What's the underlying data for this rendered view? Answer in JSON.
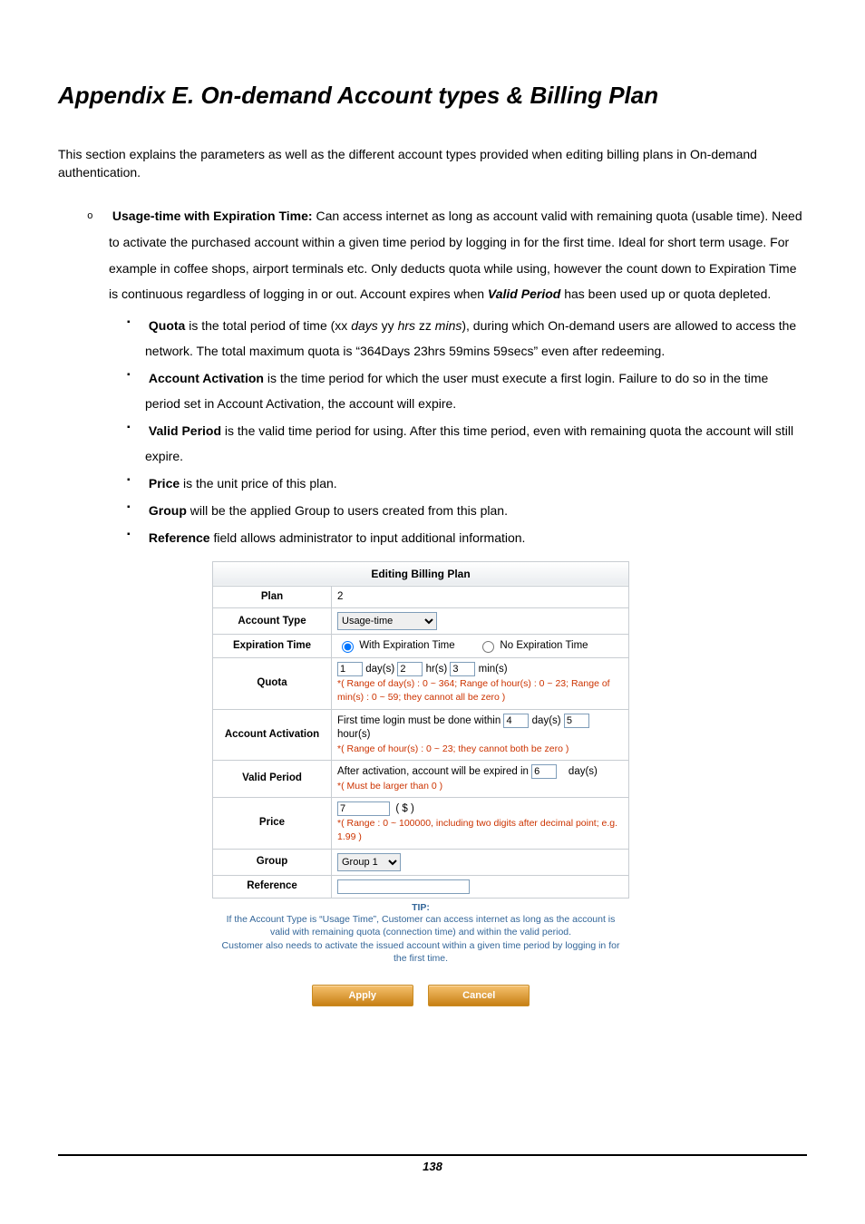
{
  "title": "Appendix E.  On-demand Account types & Billing Plan",
  "intro": "This section explains the parameters as well as the different account types provided when editing billing plans in On-demand authentication.",
  "bullet_main": {
    "strong": "Usage-time with Expiration Time:",
    "text_a": " Can access internet as long as account valid with remaining quota (usable time). Need to activate the purchased account within a given time period by logging in for the first time. Ideal for short term usage. For example in coffee shops, airport terminals etc. Only deducts quota while using, however the count down to Expiration Time is continuous regardless of logging in or out. Account expires when ",
    "emph": "Valid Period",
    "text_b": " has been used up or quota depleted."
  },
  "sub_bullets": {
    "quota": {
      "strong": "Quota",
      "a": " is the total period of time (xx ",
      "i1": "days",
      "b1": " yy ",
      "i2": "hrs",
      "b2": " zz ",
      "i3": "mins",
      "c": "), during which On-demand users are allowed to access the network. The total maximum quota is “364Days 23hrs 59mins 59secs” even after redeeming."
    },
    "activation": {
      "strong": "Account Activation",
      "text": " is the time period for which the user must execute a first login. Failure to do so in the time period set in Account Activation, the account will expire."
    },
    "valid": {
      "strong": "Valid Period",
      "text": " is the valid time period for using. After this time period, even with remaining quota the account will still expire."
    },
    "price": {
      "strong": "Price",
      "text": " is the unit price of this plan."
    },
    "group": {
      "strong": "Group",
      "text": " will be the applied Group to users created from this plan."
    },
    "reference": {
      "strong": "Reference",
      "text": " field allows administrator to input additional information."
    }
  },
  "panel": {
    "heading": "Editing Billing Plan",
    "rows": {
      "plan": {
        "label": "Plan",
        "value": "2"
      },
      "account_type": {
        "label": "Account Type",
        "select_value": "Usage-time"
      },
      "expiration": {
        "label": "Expiration Time",
        "with_label": "With Expiration Time",
        "no_label": "No Expiration Time"
      },
      "quota": {
        "label": "Quota",
        "day": "1",
        "day_unit": "day(s)",
        "hr": "2",
        "hr_unit": "hr(s)",
        "min": "3",
        "min_unit": "min(s)",
        "hint": "*( Range of day(s) : 0 ~ 364; Range of hour(s) : 0 ~ 23; Range of min(s) : 0 ~ 59; they cannot all be zero )"
      },
      "activation": {
        "label": "Account Activation",
        "text_a": "First time login must be done within ",
        "v1": "4",
        "u1": "day(s)",
        "v2": "5",
        "u2": "hour(s)",
        "hint": "*( Range of hour(s) : 0 ~ 23; they cannot both be zero )"
      },
      "valid": {
        "label": "Valid Period",
        "text_a": "After activation, account will be expired in ",
        "v": "6",
        "u": "day(s)",
        "hint": "*( Must be larger than 0 )"
      },
      "price": {
        "label": "Price",
        "v": "7",
        "currency": "( $ )",
        "hint": "*( Range : 0 ~ 100000, including two digits after decimal point; e.g. 1.99 )"
      },
      "group": {
        "label": "Group",
        "select_value": "Group 1"
      },
      "reference": {
        "label": "Reference",
        "value": ""
      }
    },
    "tip_head": "TIP:",
    "tip_1": "If the Account Type is “Usage Time”, Customer can access internet as long as the account is valid with remaining quota (connection time) and within the valid period.",
    "tip_2": "Customer also needs to activate the issued account within a given time period by logging in for the first time.",
    "apply": "Apply",
    "cancel": "Cancel"
  },
  "page_number": "138"
}
